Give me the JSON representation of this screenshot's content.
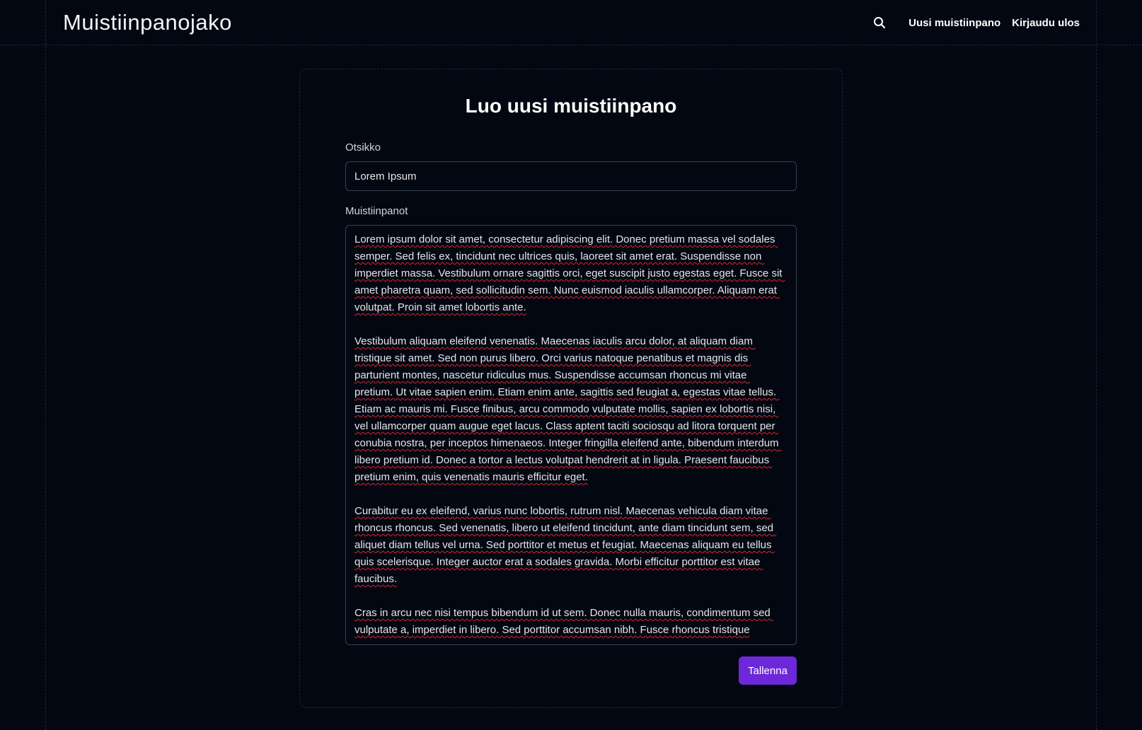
{
  "header": {
    "brand": "Muistiinpanojako",
    "search_icon": "search-icon",
    "new_note_label": "Uusi muistiinpano",
    "logout_label": "Kirjaudu ulos"
  },
  "form": {
    "heading": "Luo uusi muistiinpano",
    "title_label": "Otsikko",
    "title_value": "Lorem Ipsum",
    "notes_label": "Muistiinpanot",
    "notes_value": "Lorem ipsum dolor sit amet, consectetur adipiscing elit. Donec pretium massa vel sodales semper. Sed felis ex, tincidunt nec ultrices quis, laoreet sit amet erat. Suspendisse non imperdiet massa. Vestibulum ornare sagittis orci, eget suscipit justo egestas eget. Fusce sit amet pharetra quam, sed sollicitudin sem. Nunc euismod iaculis ullamcorper. Aliquam erat volutpat. Proin sit amet lobortis ante.\n\nVestibulum aliquam eleifend venenatis. Maecenas iaculis arcu dolor, at aliquam diam tristique sit amet. Sed non purus libero. Orci varius natoque penatibus et magnis dis parturient montes, nascetur ridiculus mus. Suspendisse accumsan rhoncus mi vitae pretium. Ut vitae sapien enim. Etiam enim ante, sagittis sed feugiat a, egestas vitae tellus. Etiam ac mauris mi. Fusce finibus, arcu commodo vulputate mollis, sapien ex lobortis nisi, vel ullamcorper quam augue eget lacus. Class aptent taciti sociosqu ad litora torquent per conubia nostra, per inceptos himenaeos. Integer fringilla eleifend ante, bibendum interdum libero pretium id. Donec a tortor a lectus volutpat hendrerit at in ligula. Praesent faucibus pretium enim, quis venenatis mauris efficitur eget.\n\nCurabitur eu ex eleifend, varius nunc lobortis, rutrum nisl. Maecenas vehicula diam vitae rhoncus rhoncus. Sed venenatis, libero ut eleifend tincidunt, ante diam tincidunt sem, sed aliquet diam tellus vel urna. Sed porttitor et metus et feugiat. Maecenas aliquam eu tellus quis scelerisque. Integer auctor erat a sodales gravida. Morbi efficitur porttitor est vitae faucibus.\n\nCras in arcu nec nisi tempus bibendum id ut sem. Donec nulla mauris, condimentum sed vulputate a, imperdiet in libero. Sed porttitor accumsan nibh. Fusce rhoncus tristique",
    "save_label": "Tallenna"
  },
  "colors": {
    "background": "#030712",
    "accent": "#6d28d9",
    "spellcheck": "#dc2626"
  }
}
